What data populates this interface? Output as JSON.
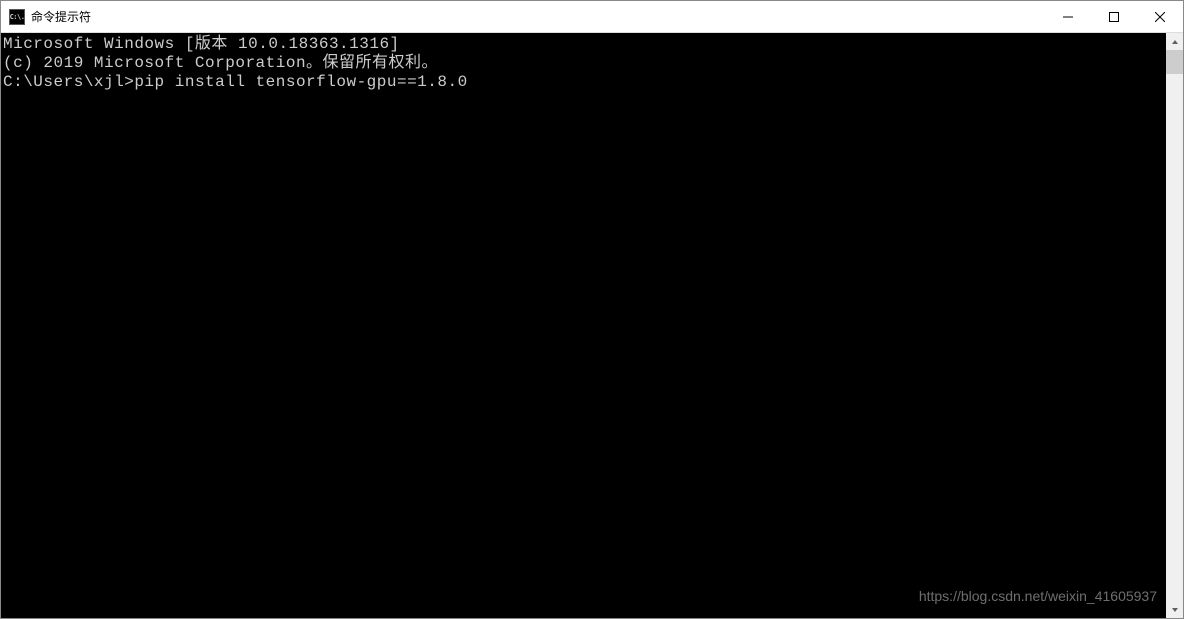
{
  "titlebar": {
    "icon_text": "C:\\.",
    "title": "命令提示符"
  },
  "terminal": {
    "line1": "Microsoft Windows [版本 10.0.18363.1316]",
    "line2": "(c) 2019 Microsoft Corporation。保留所有权利。",
    "line3": "",
    "prompt": "C:\\Users\\xjl>",
    "command": "pip install tensorflow-gpu==1.8.0"
  },
  "watermark": "https://blog.csdn.net/weixin_41605937"
}
